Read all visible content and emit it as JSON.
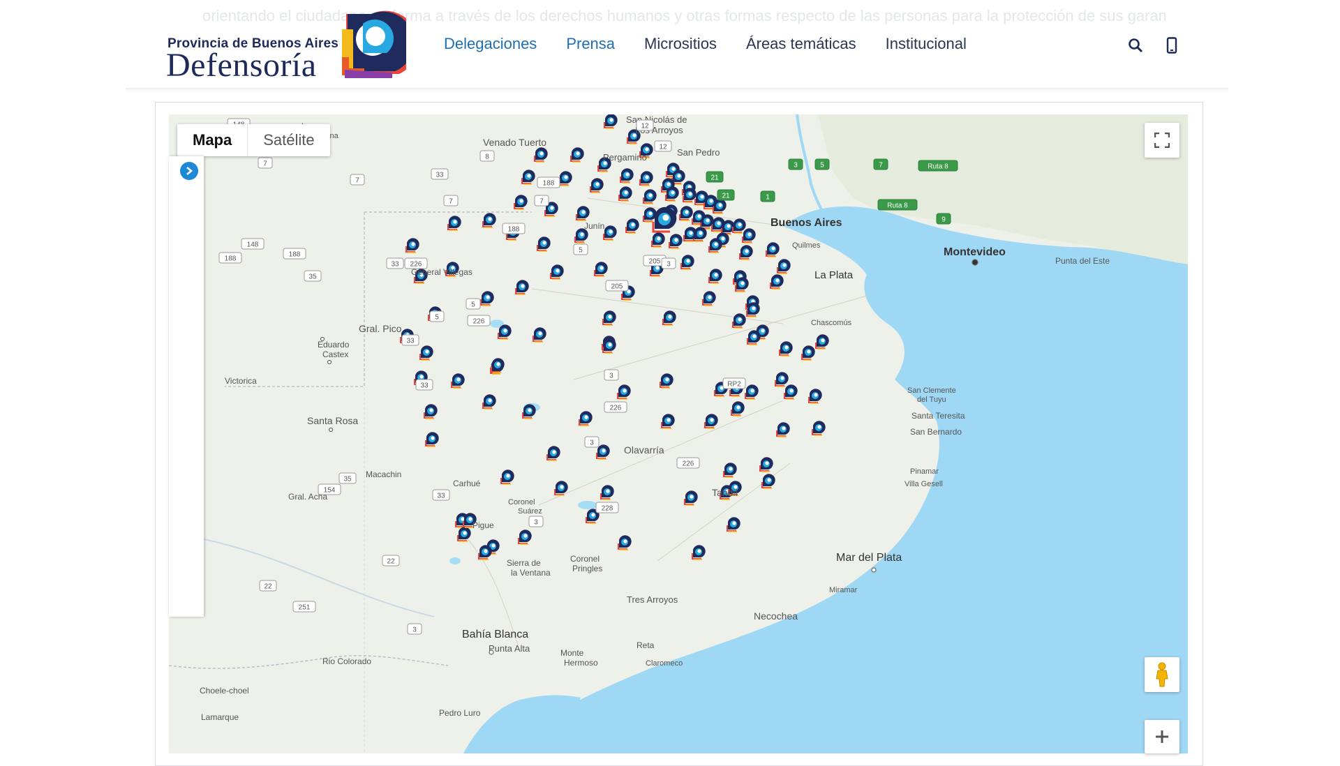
{
  "background_text": "orientando el ciudadano en forma a través de los derechos humanos y otras formas respecto de las personas para la protección de sus garantías",
  "brand": {
    "province": "Provincia de Buenos Aires",
    "name": "Defensoría"
  },
  "nav": [
    {
      "label": "Delegaciones"
    },
    {
      "label": "Prensa"
    },
    {
      "label": "Micrositios"
    },
    {
      "label": "Áreas temáticas"
    },
    {
      "label": "Institucional"
    }
  ],
  "header_icons": [
    "search-icon",
    "mobile-phone-icon"
  ],
  "map": {
    "type_controls": [
      {
        "label": "Mapa",
        "selected": true
      },
      {
        "label": "Satélite",
        "selected": false
      }
    ],
    "controls": [
      "fullscreen-icon",
      "pegman-icon",
      "zoom-in-icon",
      "panel-toggle-icon"
    ],
    "colors": {
      "water": "#9fd8f4",
      "land": "#eef0ea",
      "marker": "#1e2b5c",
      "marker_accent": "#28a8e0"
    },
    "places": [
      {
        "name": "San Nicolás de",
        "line2": "Los Arroyos"
      },
      {
        "name": "Venado Tuerto"
      },
      {
        "name": "Pergamino"
      },
      {
        "name": "San Pedro"
      },
      {
        "name": "Buenos Aires"
      },
      {
        "name": "Quilmes"
      },
      {
        "name": "La Plata"
      },
      {
        "name": "Montevideo"
      },
      {
        "name": "Punta del Este"
      },
      {
        "name": "General Villegas"
      },
      {
        "name": "Junín"
      },
      {
        "name": "Gral. Pico"
      },
      {
        "name": "Eduardo",
        "line2": "Castex"
      },
      {
        "name": "Victorica"
      },
      {
        "name": "Santa Rosa"
      },
      {
        "name": "Macachin"
      },
      {
        "name": "Gral. Acha"
      },
      {
        "name": "Chascomús"
      },
      {
        "name": "San Clemente",
        "line2": "del Tuyu"
      },
      {
        "name": "Santa Teresita"
      },
      {
        "name": "San Bernardo"
      },
      {
        "name": "Olavarría"
      },
      {
        "name": "Tandil"
      },
      {
        "name": "Pinamar"
      },
      {
        "name": "Villa Gesell"
      },
      {
        "name": "Carhué"
      },
      {
        "name": "Coronel",
        "line2": "Suárez"
      },
      {
        "name": "Pigue"
      },
      {
        "name": "Sierra de",
        "line2": "la Ventana"
      },
      {
        "name": "Coronel",
        "line2": "Pringles"
      },
      {
        "name": "Mar del Plata"
      },
      {
        "name": "Miramar"
      },
      {
        "name": "Tres Arroyos"
      },
      {
        "name": "Necochea"
      },
      {
        "name": "Bahía Blanca"
      },
      {
        "name": "Punta Alta"
      },
      {
        "name": "Monte",
        "line2": "Hermoso"
      },
      {
        "name": "Reta"
      },
      {
        "name": "Claromeco"
      },
      {
        "name": "Rio Colorado"
      },
      {
        "name": "Choele-choel"
      },
      {
        "name": "Lamarque"
      },
      {
        "name": "Pedro Luro"
      },
      {
        "name": "Laguna",
        "line2": "Mackenna"
      }
    ],
    "route_shields": [
      "148",
      "7",
      "7",
      "33",
      "8",
      "12",
      "12",
      "188",
      "7",
      "7",
      "5",
      "188",
      "226",
      "33",
      "205",
      "3",
      "205",
      "148",
      "188",
      "188",
      "35",
      "5",
      "226",
      "33",
      "33",
      "3",
      "226",
      "RP2",
      "3",
      "226",
      "228",
      "3",
      "22",
      "22",
      "251",
      "3",
      "154",
      "35",
      "33",
      "5",
      "21",
      "21",
      "1",
      "5",
      "3",
      "7",
      "Ruta 8",
      "Ruta 8",
      "9"
    ]
  }
}
